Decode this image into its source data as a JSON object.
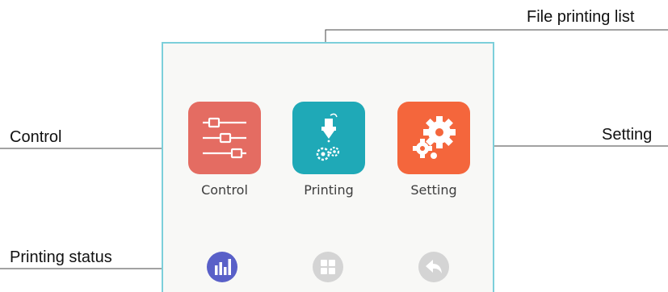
{
  "menu": {
    "tiles": [
      {
        "label": "Control",
        "icon": "sliders-icon",
        "color": "#e46c62"
      },
      {
        "label": "Printing",
        "icon": "print-nozzle-icon",
        "color": "#1fa9b7"
      },
      {
        "label": "Setting",
        "icon": "gears-icon",
        "color": "#f4663c"
      }
    ],
    "nav": [
      {
        "icon": "bar-chart-icon",
        "color": "#5960c8",
        "active": true
      },
      {
        "icon": "grid-icon",
        "color": "#d4d4d4",
        "active": false
      },
      {
        "icon": "back-arrow-icon",
        "color": "#d4d4d4",
        "active": false
      }
    ],
    "border_color": "#7ccfda"
  },
  "annotations": {
    "file_printing_list": "File printing list",
    "control": "Control",
    "setting": "Setting",
    "printing_status": "Printing status"
  }
}
